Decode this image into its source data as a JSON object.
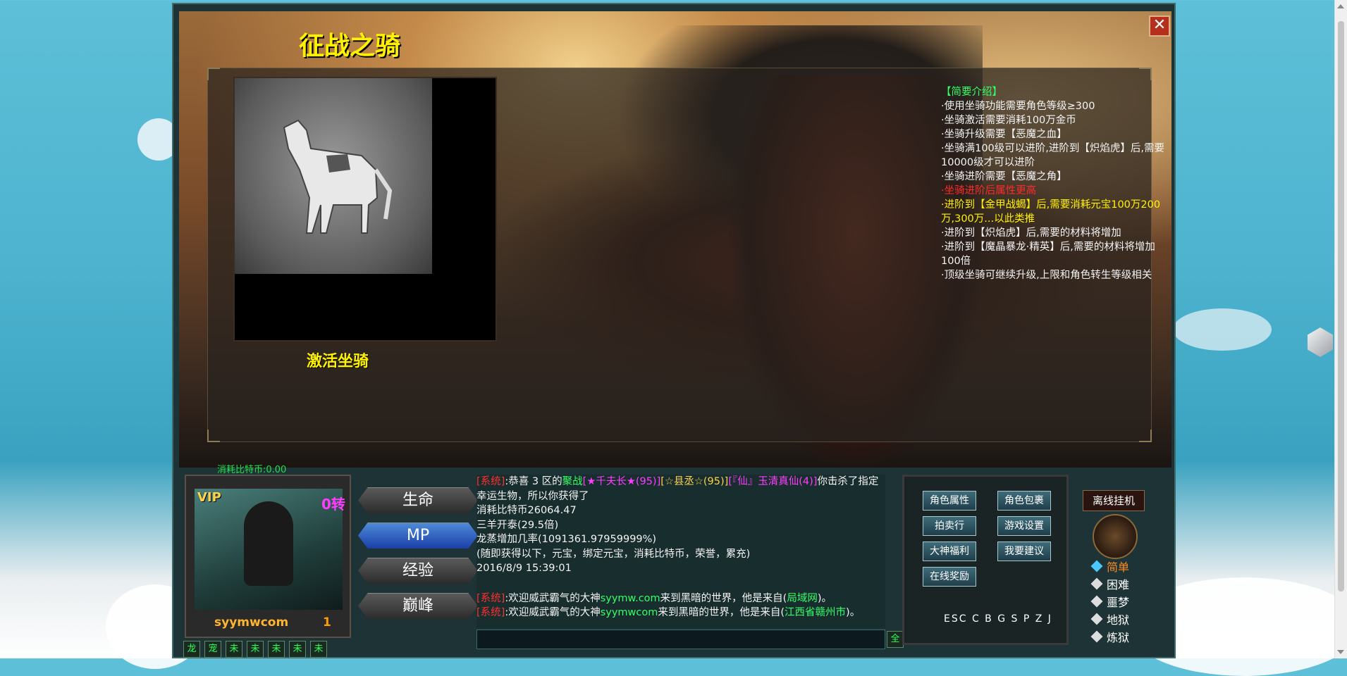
{
  "window": {
    "title": "征战之骑",
    "close_icon": "✕"
  },
  "mount": {
    "activate_label": "激活坐骑"
  },
  "intro": {
    "heading": "【简要介绍】",
    "lines": [
      "·使用坐骑功能需要角色等级≥300",
      "·坐骑激活需要消耗100万金币",
      "·坐骑升级需要【恶魔之血】",
      "·坐骑满100级可以进阶,进阶到【炽焰虎】后,需要10000级才可以进阶",
      "·坐骑进阶需要【恶魔之角】"
    ],
    "red_line": "·坐骑进阶后属性更高",
    "yellow_line": "·进阶到【金甲战蝎】后,需要消耗元宝100万200万,300万...以此类推",
    "tail_lines": [
      "·进阶到【炽焰虎】后,需要的材料将增加",
      "·进阶到【魔晶暴龙·精英】后,需要的材料将增加100倍",
      "·顶级坐骑可继续升级,上限和角色转生等级相关"
    ]
  },
  "hud": {
    "cost_text": "消耗比特币:0.00",
    "vip": "VIP",
    "zhuan": "0转",
    "player_name": "syymwcom",
    "level": "1",
    "mini_buttons": [
      "龙",
      "宠",
      "未",
      "未",
      "未",
      "未",
      "未"
    ],
    "stat_buttons": [
      "生命",
      "MP",
      "经验",
      "巅峰"
    ],
    "all_button": "全"
  },
  "chat": {
    "line1": {
      "sys": "[系统]",
      "a": ":恭喜 3 区的",
      "b": "聚战",
      "c": "[★千夫长★(95)]",
      "d": "[☆县丞☆(95)]",
      "e": "[『仙』玉清真仙(4)]",
      "f": "你击杀了指定幸运生物，所以你获得了"
    },
    "plain": [
      "消耗比特币26064.47",
      "三羊开泰(29.5倍)",
      "龙蒸增加几率(1091361.97959999%)",
      "(随即获得以下，元宝，绑定元宝，消耗比特币，荣誉，累充)",
      "2016/8/9 15:39:01"
    ],
    "welcome1": {
      "sys": "[系统]",
      "a": ":欢迎威武霸气的大神",
      "name": "syymw.com",
      "b": "来到黑暗的世界，他是来自(",
      "place": "局域网",
      "c": ")。"
    },
    "welcome2": {
      "sys": "[系统]",
      "a": ":欢迎威武霸气的大神",
      "name": "syymwcom",
      "b": "来到黑暗的世界，他是来自(",
      "place": "江西省赣州市",
      "c": ")。"
    }
  },
  "menu": {
    "buttons": [
      "角色属性",
      "角色包裹",
      "拍卖行",
      "游戏设置",
      "大神福利",
      "我要建议",
      "在线奖励"
    ],
    "shortcut": "ESC C B G S P Z J"
  },
  "side": {
    "offline_label": "离线挂机",
    "difficulties": [
      "简单",
      "困难",
      "噩梦",
      "地狱",
      "炼狱"
    ],
    "selected": "简单",
    "selected_color": "#ff8c1a",
    "normal_color": "#ffffff"
  }
}
